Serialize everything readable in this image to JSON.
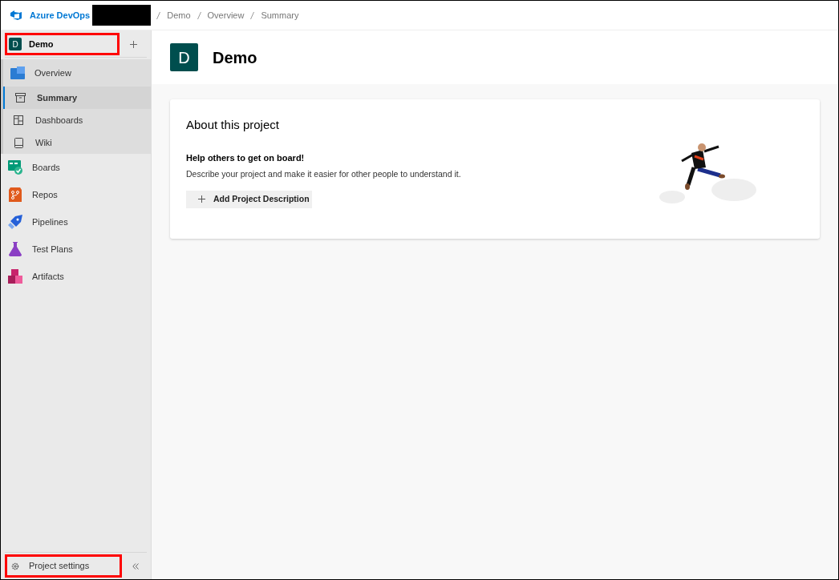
{
  "topbar": {
    "brand": "Azure DevOps",
    "breadcrumbs": [
      "Demo",
      "Overview",
      "Summary"
    ]
  },
  "sidebar": {
    "project": {
      "initial": "D",
      "name": "Demo",
      "highlighted": true
    },
    "items": [
      {
        "label": "Overview",
        "kind": "overview",
        "selected": false,
        "expanded": true,
        "children": [
          {
            "label": "Summary",
            "kind": "summary",
            "selected": true
          },
          {
            "label": "Dashboards",
            "kind": "dashboards",
            "selected": false
          },
          {
            "label": "Wiki",
            "kind": "wiki",
            "selected": false
          }
        ]
      },
      {
        "label": "Boards",
        "kind": "boards",
        "selected": false,
        "expanded": false
      },
      {
        "label": "Repos",
        "kind": "repos",
        "selected": false,
        "expanded": false
      },
      {
        "label": "Pipelines",
        "kind": "pipelines",
        "selected": false,
        "expanded": false
      },
      {
        "label": "Test Plans",
        "kind": "testplans",
        "selected": false,
        "expanded": false
      },
      {
        "label": "Artifacts",
        "kind": "artifacts",
        "selected": false,
        "expanded": false
      }
    ],
    "settings": {
      "label": "Project settings",
      "highlighted": true
    }
  },
  "header": {
    "initial": "D",
    "title": "Demo"
  },
  "about_card": {
    "title": "About this project",
    "heading": "Help others to get on board!",
    "description": "Describe your project and make it easier for other people to understand it.",
    "button": "Add Project Description"
  }
}
